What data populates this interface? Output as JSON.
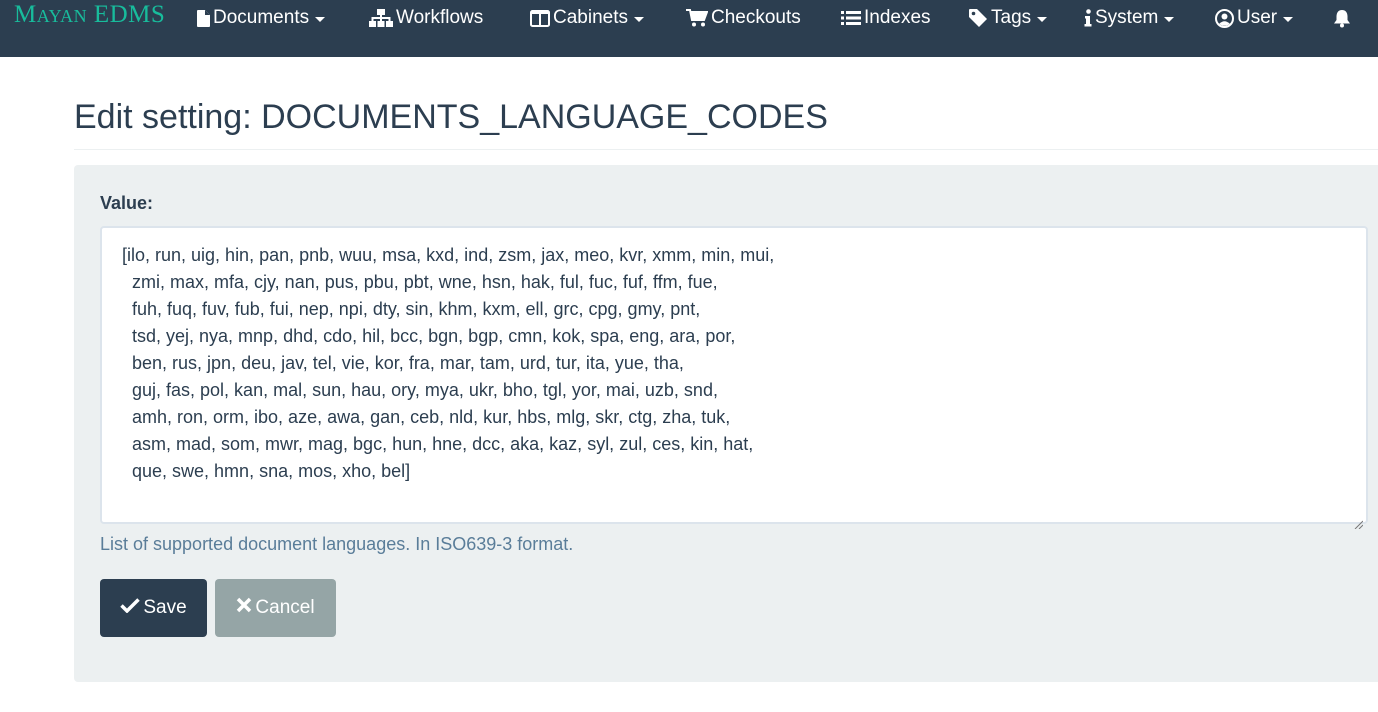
{
  "navbar": {
    "brand": "Mayan EDMS",
    "items": [
      {
        "label": "Documents",
        "icon": "file-icon",
        "dropdown": true
      },
      {
        "label": "Workflows",
        "icon": "sitemap-icon",
        "dropdown": false
      },
      {
        "label": "Cabinets",
        "icon": "columns-icon",
        "dropdown": true
      },
      {
        "label": "Checkouts",
        "icon": "shopping-cart-icon",
        "dropdown": false
      },
      {
        "label": "Indexes",
        "icon": "list-icon",
        "dropdown": false
      },
      {
        "label": "Tags",
        "icon": "tag-icon",
        "dropdown": true
      },
      {
        "label": "System",
        "icon": "info-icon",
        "dropdown": true
      },
      {
        "label": "User",
        "icon": "user-circle-icon",
        "dropdown": true
      }
    ],
    "notifications_icon": "bell-icon"
  },
  "page": {
    "title": "Edit setting: DOCUMENTS_LANGUAGE_CODES"
  },
  "form": {
    "value_label": "Value:",
    "value_lines": [
      "[ilo, run, uig, hin, pan, pnb, wuu, msa, kxd, ind, zsm, jax, meo, kvr, xmm, min, mui,",
      "  zmi, max, mfa, cjy, nan, pus, pbu, pbt, wne, hsn, hak, ful, fuc, fuf, ffm, fue,",
      "  fuh, fuq, fuv, fub, fui, nep, npi, dty, sin, khm, kxm, ell, grc, cpg, gmy, pnt,",
      "  tsd, yej, nya, mnp, dhd, cdo, hil, bcc, bgn, bgp, cmn, kok, spa, eng, ara, por,",
      "  ben, rus, jpn, deu, jav, tel, vie, kor, fra, mar, tam, urd, tur, ita, yue, tha,",
      "  guj, fas, pol, kan, mal, sun, hau, ory, mya, ukr, bho, tgl, yor, mai, uzb, snd,",
      "  amh, ron, orm, ibo, aze, awa, gan, ceb, nld, kur, hbs, mlg, skr, ctg, zha, tuk,",
      "  asm, mad, som, mwr, mag, bgc, hun, hne, dcc, aka, kaz, syl, zul, ces, kin, hat,",
      "  que, swe, hmn, sna, mos, xho, bel]"
    ],
    "help_text": "List of supported document languages. In ISO639-3 format.",
    "save_label": "Save",
    "save_icon": "check-icon",
    "cancel_label": "Cancel",
    "cancel_icon": "times-icon"
  },
  "colors": {
    "navbar_bg": "#2c3e50",
    "brand": "#18bc9c",
    "well_bg": "#ecf0f1",
    "save_bg": "#2c3e50",
    "cancel_bg": "#95a5a6",
    "help_text": "#5a7d99"
  }
}
